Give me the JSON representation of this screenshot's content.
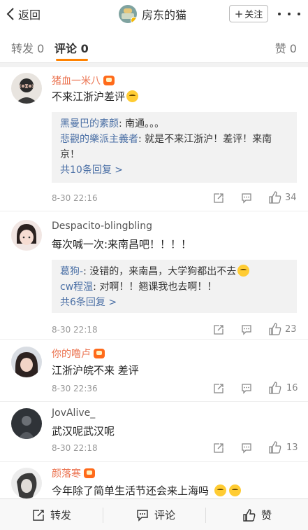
{
  "header": {
    "back_label": "返回",
    "title": "房东的猫",
    "follow_label": "关注"
  },
  "tabs": {
    "repost": "转发 0",
    "comment": "评论 0",
    "like": "赞 0"
  },
  "comments": [
    {
      "user": "猪血一米八",
      "text": "不来江浙沪差评",
      "replies": [
        {
          "name": "黑曼巴的素颜",
          "text": "南通。。。"
        },
        {
          "name": "悲觀的樂派主義者",
          "text": "就是不来江浙沪！差评！来南京！"
        }
      ],
      "more_replies": "共10条回复 >",
      "time": "8-30 22:16",
      "likes": "34"
    },
    {
      "user": "Despacito-blingbling",
      "text": "每次喊一次:来南昌吧！！！！",
      "replies": [
        {
          "name": "葛狗-",
          "text": "没错的，来南昌，大学狗都出不去"
        },
        {
          "name": "cw程温",
          "text": "对啊！！翘课我也去啊！！"
        }
      ],
      "more_replies": "共6条回复 >",
      "time": "8-30 22:18",
      "likes": "23"
    },
    {
      "user": "你的噜卢",
      "text": "江浙沪皖不来 差评",
      "time": "8-30 22:36",
      "likes": "16"
    },
    {
      "user": "JovAlive_",
      "text": "武汉呢武汉呢",
      "time": "8-30 22:18",
      "likes": "13"
    },
    {
      "user": "颜落寒",
      "text": "今年除了简单生活节还会来上海吗"
    }
  ],
  "bottom_bar": {
    "repost": "转发",
    "comment": "评论",
    "like": "赞"
  },
  "colors": {
    "accent": "#ff8200",
    "username": "#eb7350",
    "reply_name": "#4a6fa5"
  }
}
